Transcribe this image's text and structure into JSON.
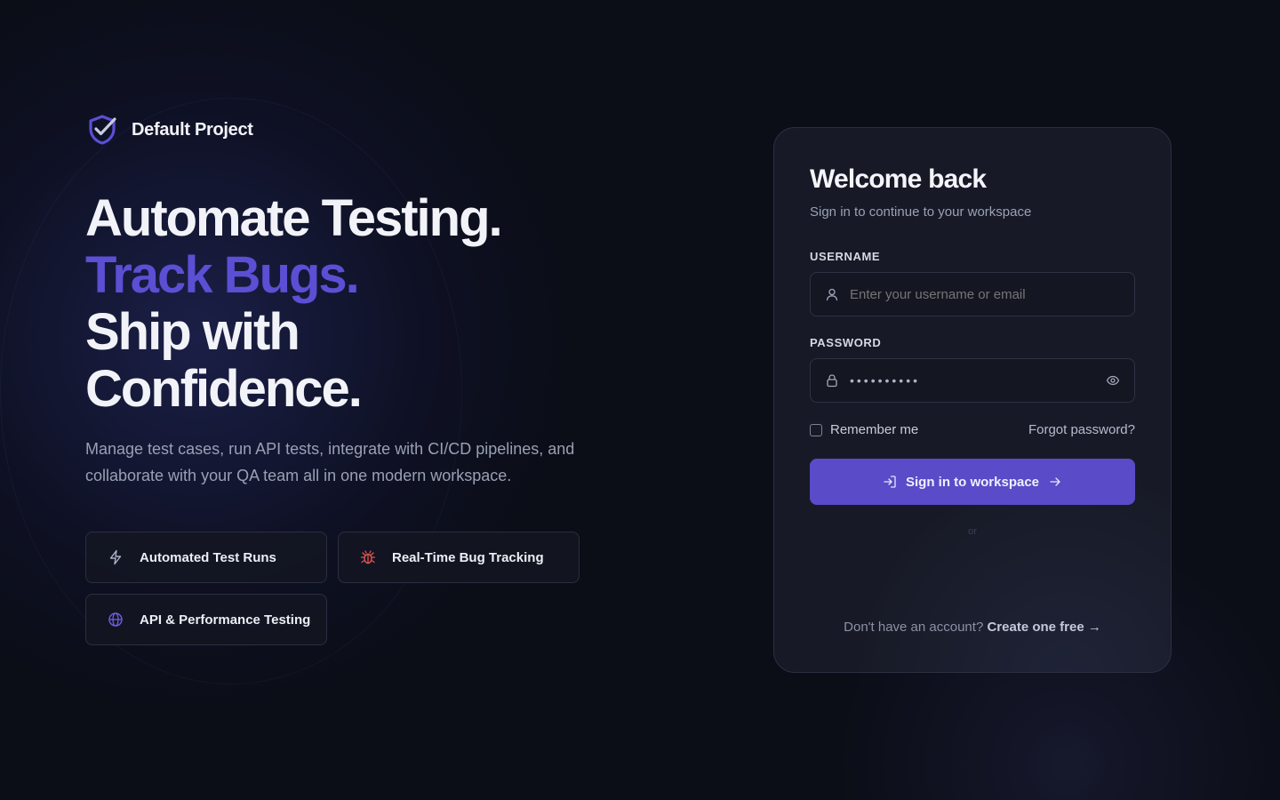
{
  "brand": {
    "name": "Default Project",
    "logo_icon": "shield-check-icon",
    "accent_color": "#5b4fd4"
  },
  "hero": {
    "line1": "Automate Testing.",
    "line2": "Track Bugs.",
    "line3": "Ship with",
    "line4": "Confidence."
  },
  "subtitle": "Manage test cases, run API tests, integrate with CI/CD pipelines, and collaborate with your QA team all in one modern workspace.",
  "features": [
    {
      "label": "Automated Test Runs",
      "icon": "lightning-icon"
    },
    {
      "label": "Real-Time Bug Tracking",
      "icon": "bug-icon",
      "icon_color": "#e25555"
    },
    {
      "label": "API & Performance Testing",
      "icon": "globe-icon",
      "icon_color": "#6d5ee0"
    }
  ],
  "login": {
    "title": "Welcome back",
    "subtitle": "Sign in to continue to your workspace",
    "username_label": "USERNAME",
    "username_placeholder": "Enter your username or email",
    "password_label": "PASSWORD",
    "password_value": "••••••••••",
    "remember_label": "Remember me",
    "remember_checked": false,
    "forgot_label": "Forgot password?",
    "submit_label": "Sign in to workspace",
    "submit_color": "#5a4bc8",
    "divider_text": "or",
    "signup_prompt": "Don't have an account?",
    "signup_link": "Create one free →"
  }
}
